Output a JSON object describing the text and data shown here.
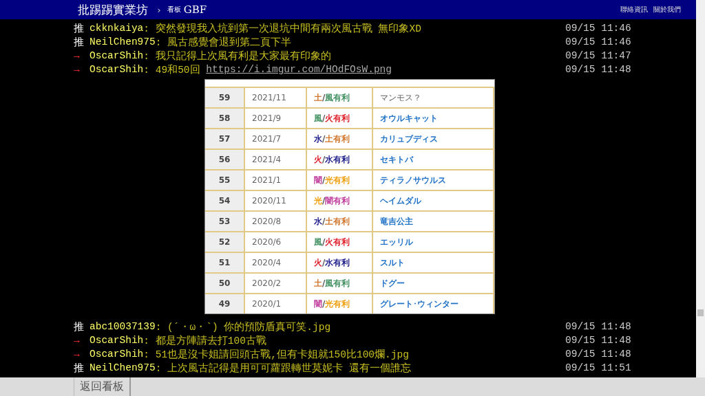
{
  "header": {
    "site": "批踢踢實業坊",
    "separator": "›",
    "board_label": "看板",
    "board": "GBF",
    "links": [
      "聯絡資訊",
      "關於我們"
    ]
  },
  "pushes_before": [
    {
      "kind": "push",
      "tag": "推",
      "user": "ckknkaiya",
      "content": ": 突然發現我入坑到第一次退坑中間有兩次風古戰 無印象XD",
      "time": "09/15 11:46"
    },
    {
      "kind": "push",
      "tag": "推",
      "user": "NeilChen975",
      "content": ": 風古感覺會退到第二頁下半",
      "time": "09/15 11:46"
    },
    {
      "kind": "arrow",
      "tag": "→",
      "user": "OscarShih",
      "content": ": 我只記得上次風有利是大家最有印象的",
      "time": "09/15 11:47"
    },
    {
      "kind": "arrow",
      "tag": "→",
      "user": "OscarShih",
      "content": ": 49和50回 ",
      "link": "https://i.imgur.com/HOdFOsW.png",
      "time": "09/15 11:48"
    }
  ],
  "image_table": {
    "rows": [
      {
        "number": "59",
        "date": "2021/11",
        "element": [
          {
            "text": "土",
            "color": "#d2762e"
          },
          {
            "text": "/",
            "color": "#555555"
          },
          {
            "text": "風有利",
            "color": "#3f9060"
          }
        ],
        "name": "マンモス？",
        "confirmed": false
      },
      {
        "number": "58",
        "date": "2021/9",
        "element": [
          {
            "text": "風",
            "color": "#3f9060"
          },
          {
            "text": "/",
            "color": "#555555"
          },
          {
            "text": "火有利",
            "color": "#e0202a"
          }
        ],
        "name": "オウルキャット",
        "confirmed": true
      },
      {
        "number": "57",
        "date": "2021/7",
        "element": [
          {
            "text": "水",
            "color": "#1c1c8a"
          },
          {
            "text": "/",
            "color": "#555555"
          },
          {
            "text": "土有利",
            "color": "#d2762e"
          }
        ],
        "name": "カリュブディス",
        "confirmed": true
      },
      {
        "number": "56",
        "date": "2021/4",
        "element": [
          {
            "text": "火",
            "color": "#e0202a"
          },
          {
            "text": "/",
            "color": "#555555"
          },
          {
            "text": "水有利",
            "color": "#1c1c8a"
          }
        ],
        "name": "セキトバ",
        "confirmed": true
      },
      {
        "number": "55",
        "date": "2021/1",
        "element": [
          {
            "text": "闇",
            "color": "#c03a9c"
          },
          {
            "text": "/",
            "color": "#555555"
          },
          {
            "text": "光有利",
            "color": "#f0a010"
          }
        ],
        "name": "ティラノサウルス",
        "confirmed": true
      },
      {
        "number": "54",
        "date": "2020/11",
        "element": [
          {
            "text": "光",
            "color": "#f0a010"
          },
          {
            "text": "/",
            "color": "#555555"
          },
          {
            "text": "闇有利",
            "color": "#c03a9c"
          }
        ],
        "name": "ヘイムダル",
        "confirmed": true
      },
      {
        "number": "53",
        "date": "2020/8",
        "element": [
          {
            "text": "水",
            "color": "#1c1c8a"
          },
          {
            "text": "/",
            "color": "#555555"
          },
          {
            "text": "土有利",
            "color": "#d2762e"
          }
        ],
        "name": "竜吉公主",
        "confirmed": true
      },
      {
        "number": "52",
        "date": "2020/6",
        "element": [
          {
            "text": "風",
            "color": "#3f9060"
          },
          {
            "text": "/",
            "color": "#555555"
          },
          {
            "text": "火有利",
            "color": "#e0202a"
          }
        ],
        "name": "エッリル",
        "confirmed": true
      },
      {
        "number": "51",
        "date": "2020/4",
        "element": [
          {
            "text": "火",
            "color": "#e0202a"
          },
          {
            "text": "/",
            "color": "#555555"
          },
          {
            "text": "水有利",
            "color": "#1c1c8a"
          }
        ],
        "name": "スルト",
        "confirmed": true
      },
      {
        "number": "50",
        "date": "2020/2",
        "element": [
          {
            "text": "土",
            "color": "#d2762e"
          },
          {
            "text": "/",
            "color": "#555555"
          },
          {
            "text": "風有利",
            "color": "#3f9060"
          }
        ],
        "name": "ドグー",
        "confirmed": true
      },
      {
        "number": "49",
        "date": "2020/1",
        "element": [
          {
            "text": "闇",
            "color": "#c03a9c"
          },
          {
            "text": "/",
            "color": "#555555"
          },
          {
            "text": "光有利",
            "color": "#f0a010"
          }
        ],
        "name": "グレート･ウィンター",
        "confirmed": true
      }
    ]
  },
  "pushes_after": [
    {
      "kind": "push",
      "tag": "推",
      "user": "abc10037139",
      "content": ": (´・ω・`) 你的預防盾真可笑.jpg",
      "time": "09/15 11:48"
    },
    {
      "kind": "arrow",
      "tag": "→",
      "user": "OscarShih",
      "content": ": 都是方陣請去打100古戰",
      "time": "09/15 11:48"
    },
    {
      "kind": "arrow",
      "tag": "→",
      "user": "OscarShih",
      "content": ": 51也是沒卡姐請回頭古戰,但有卡姐就150比100爛.jpg",
      "time": "09/15 11:48"
    },
    {
      "kind": "push",
      "tag": "推",
      "user": "NeilChen975",
      "content": ": 上次風古記得是用可可蘿跟轉世莫妮卡 還有一個誰忘",
      "time": "09/15 11:51"
    }
  ],
  "bottom_bar": {
    "back_button": "返回看板"
  }
}
